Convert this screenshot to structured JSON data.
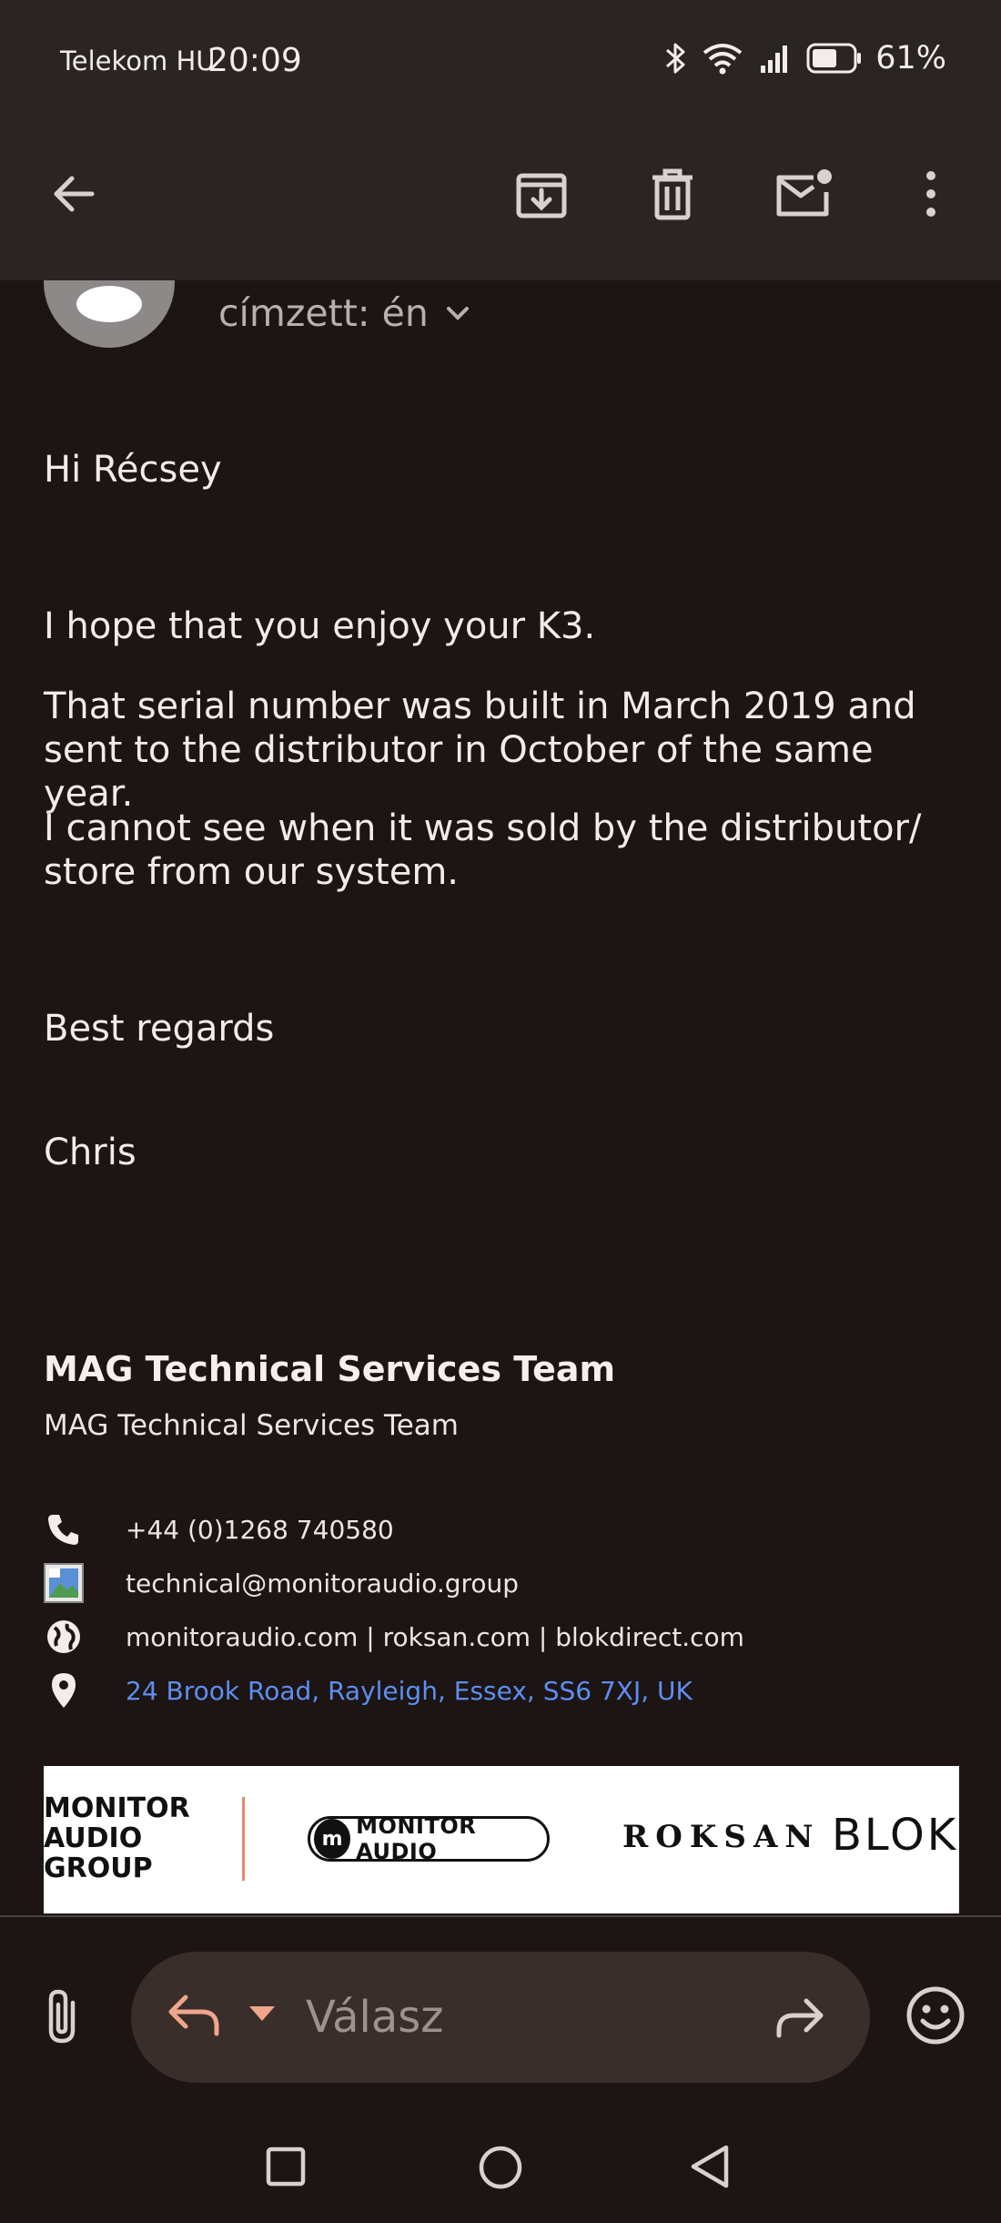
{
  "status_bar": {
    "carrier": "Telekom HU",
    "time": "20:09",
    "battery": "61%",
    "icons": [
      "bluetooth-icon",
      "wifi-icon",
      "signal-icon",
      "battery-icon"
    ]
  },
  "toolbar": {
    "back": "back-arrow-icon",
    "archive": "archive-icon",
    "delete": "trash-icon",
    "mark_unread": "mark-unread-icon",
    "more": "more-vert-icon"
  },
  "header": {
    "recipient": "címzett: én"
  },
  "message": {
    "greeting": "Hi Récsey",
    "para1": "I hope that you enjoy your K3.",
    "para2": "That serial number was built in March 2019 and sent to the distributor in October of the same year.",
    "para3": "I cannot see when it was sold by the distributor/ store from our system.",
    "closing": "Best regards",
    "name": "Chris"
  },
  "signature": {
    "title": "MAG Technical Services Team",
    "subtitle": "MAG Technical Services Team",
    "phone": "+44 (0)1268 740580",
    "email": "technical@monitoraudio.group",
    "websites": "monitoraudio.com | roksan.com | blokdirect.com",
    "address": "24 Brook Road, Rayleigh, Essex, SS6 7XJ, UK"
  },
  "banner": {
    "group_line1": "MONITOR",
    "group_line2": "AUDIO",
    "group_line3": "GROUP",
    "monitor_audio": "MONITOR AUDIO",
    "roksan": "ROKSAN",
    "blok": "BLOK"
  },
  "compose": {
    "placeholder": "Válasz"
  },
  "colors": {
    "background": "#1c1514",
    "toolbar": "#2a2422",
    "link": "#5e8ef0",
    "reply_accent": "#f0a68c",
    "reply_pill": "#3a2e2b"
  }
}
